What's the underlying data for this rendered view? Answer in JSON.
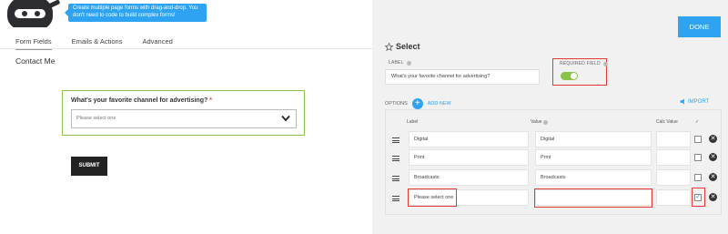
{
  "header": {
    "tooltip": "Create multiple page forms with drag-and-drop. You don't need to code to build complex forms!"
  },
  "tabs": [
    {
      "label": "Form Fields"
    },
    {
      "label": "Emails & Actions"
    },
    {
      "label": "Advanced"
    }
  ],
  "form": {
    "title": "Contact Me",
    "field_label": "What's your favorite channel for advertising?",
    "required_marker": "*",
    "select_placeholder": "Please select one",
    "submit_label": "SUBMIT"
  },
  "drawer": {
    "done_label": "DONE",
    "title": "Select",
    "label_caption": "LABEL",
    "label_value": "What's your favorite channel for advertising?",
    "required_caption": "REQUIRED FIELD",
    "required_on": true,
    "options_caption": "OPTIONS",
    "add_new_label": "ADD NEW",
    "import_label": "IMPORT",
    "columns": {
      "label": "Label",
      "value": "Value",
      "calc": "Calc Value",
      "selected": "✓"
    },
    "options": [
      {
        "label": "Digital",
        "value": "Digital",
        "calc": "",
        "selected": false
      },
      {
        "label": "Print",
        "value": "Print",
        "calc": "",
        "selected": false
      },
      {
        "label": "Broadcasts",
        "value": "Broadcasts",
        "calc": "",
        "selected": false
      },
      {
        "label": "Please select one",
        "value": "",
        "calc": "",
        "selected": true
      }
    ]
  },
  "colors": {
    "accent": "#2ea3f2",
    "toggle_on": "#8bc34a",
    "highlight": "#e53935"
  }
}
